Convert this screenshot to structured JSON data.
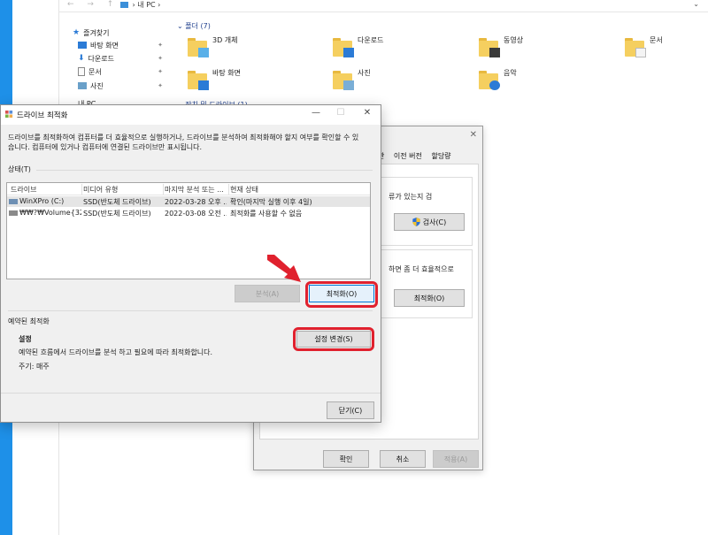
{
  "explorer": {
    "nav_arrows": "← → ↑",
    "address": "› 내 PC ›",
    "nav": {
      "quick_access": "즐겨찾기",
      "items": [
        {
          "label": "바탕 화면"
        },
        {
          "label": "다운로드"
        },
        {
          "label": "문서"
        },
        {
          "label": "사진"
        }
      ],
      "partial_item": "내 PC"
    },
    "folders_header": "폴더 (7)",
    "folders": [
      "3D 개체",
      "다운로드",
      "동영상",
      "문서",
      "바탕 화면",
      "사진",
      "음악"
    ],
    "devices_header": "장치 및 드라이브 (1)"
  },
  "props_window": {
    "close": "✕",
    "tabs": [
      "관",
      "이전 버전",
      "할당량"
    ],
    "check_text": "류가 있는지 검",
    "check_button": "검사(C)",
    "optimize_text": "하면 좀 더 효율적으로",
    "optimize_button": "최적화(O)",
    "ok": "확인",
    "cancel": "취소",
    "apply": "적용(A)"
  },
  "dialog": {
    "title": "드라이브 최적화",
    "minimize": "—",
    "maximize": "☐",
    "close": "✕",
    "description": "드라이브를 최적화하여 컴퓨터를 더 효율적으로 실행하거나, 드라이브를 분석하여 최적화해야 할지 여부를 확인할 수 있습니다. 컴퓨터에 있거나 컴퓨터에 연결된 드라이브만 표시됩니다.",
    "status_label": "상태(T)",
    "columns": [
      "드라이브",
      "미디어 유형",
      "마지막 분석 또는 ...",
      "현재 상태"
    ],
    "rows": [
      {
        "drive": "WinXPro (C:)",
        "media": "SSD(반도체 드라이브)",
        "last": "2022-03-28 오후 ...",
        "status": "확인(마지막 실행 이후 4일)"
      },
      {
        "drive": "₩₩?₩Volume{322...",
        "media": "SSD(반도체 드라이브)",
        "last": "2022-03-08 오전 ...",
        "status": "최적화를 사용할 수 없음"
      }
    ],
    "analyze_button": "분석(A)",
    "optimize_button": "최적화(O)",
    "scheduled_label": "예약된 최적화",
    "settings_label": "설정",
    "change_settings_button": "설정 변경(S)",
    "scheduled_desc": "예약된 흐름에서 드라이브를 분석 하고 필요에 따라 최적화합니다.",
    "frequency": "주기: 매주",
    "close_button": "닫기(C)"
  },
  "colors": {
    "highlight": "#e0212e",
    "accent": "#0078d7",
    "desktop": "#1e90e8"
  }
}
